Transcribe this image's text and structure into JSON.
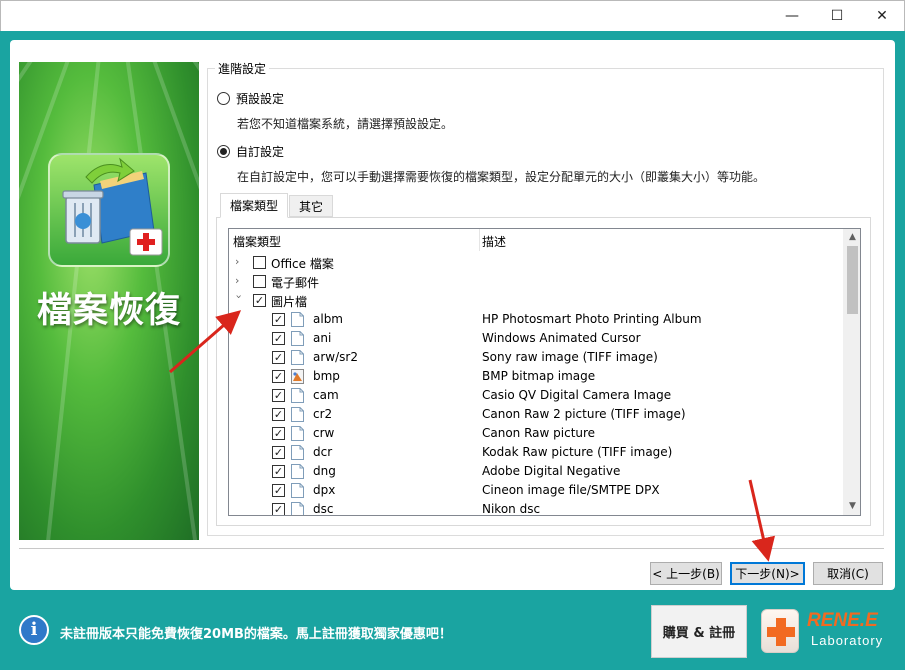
{
  "window": {
    "minimize_glyph": "—",
    "maximize_glyph": "☐",
    "close_glyph": "✕"
  },
  "banner": {
    "title": "檔案恢復"
  },
  "advanced": {
    "legend": "進階設定",
    "option_default": {
      "label": "預設設定",
      "hint": "若您不知道檔案系統，請選擇預設設定。",
      "selected": false
    },
    "option_custom": {
      "label": "自訂設定",
      "hint": "在自訂設定中，您可以手動選擇需要恢復的檔案類型，設定分配單元的大小（即叢集大小）等功能。",
      "selected": true
    }
  },
  "tabs": [
    {
      "label": "檔案類型",
      "active": true
    },
    {
      "label": "其它",
      "active": false
    }
  ],
  "list": {
    "header_type": "檔案類型",
    "header_desc": "描述",
    "categories": [
      {
        "label": "Office 檔案",
        "expanded": false,
        "checked": false
      },
      {
        "label": "電子郵件",
        "expanded": false,
        "checked": false
      },
      {
        "label": "圖片檔",
        "expanded": true,
        "checked": true
      }
    ],
    "items": [
      {
        "ext": "albm",
        "desc": "HP Photosmart Photo Printing Album",
        "icon": "file-icon"
      },
      {
        "ext": "ani",
        "desc": "Windows Animated Cursor",
        "icon": "file-icon"
      },
      {
        "ext": "arw/sr2",
        "desc": "Sony raw image (TIFF image)",
        "icon": "file-icon"
      },
      {
        "ext": "bmp",
        "desc": "BMP bitmap image",
        "icon": "paint-icon"
      },
      {
        "ext": "cam",
        "desc": "Casio QV Digital Camera Image",
        "icon": "file-icon"
      },
      {
        "ext": "cr2",
        "desc": "Canon Raw 2 picture (TIFF image)",
        "icon": "file-icon"
      },
      {
        "ext": "crw",
        "desc": "Canon Raw picture",
        "icon": "file-icon"
      },
      {
        "ext": "dcr",
        "desc": "Kodak Raw picture (TIFF image)",
        "icon": "file-icon"
      },
      {
        "ext": "dng",
        "desc": "Adobe Digital Negative",
        "icon": "file-icon"
      },
      {
        "ext": "dpx",
        "desc": "Cineon image file/SMTPE DPX",
        "icon": "file-icon"
      },
      {
        "ext": "dsc",
        "desc": "Nikon dsc",
        "icon": "file-icon"
      }
    ]
  },
  "buttons": {
    "back": "< 上一步(B)",
    "next": "下一步(N)>",
    "cancel": "取消(C)"
  },
  "footer": {
    "notice": "未註冊版本只能免費恢復20MB的檔案。馬上註冊獲取獨家優惠吧！",
    "buy_register": "購買 & 註冊",
    "logo_name": "RENE.E",
    "logo_sub": "Laboratory"
  },
  "colors": {
    "frame": "#1aa4a1",
    "banner_green": "#55bc3d",
    "arrow_red": "#d9261c",
    "logo_orange": "#f26a21"
  }
}
